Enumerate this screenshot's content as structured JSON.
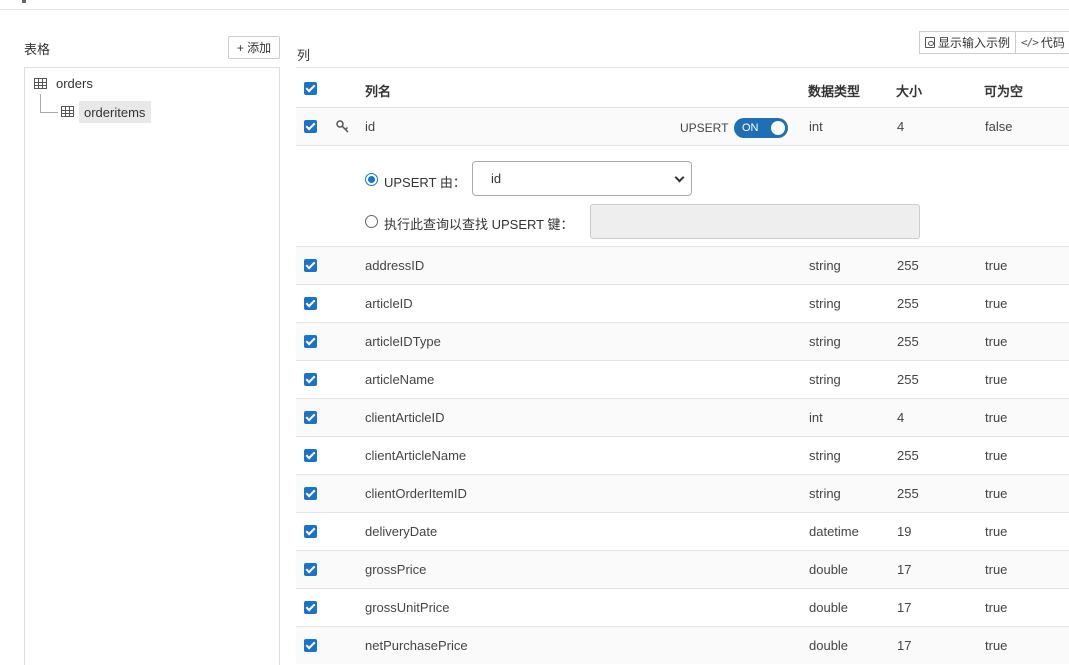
{
  "left_panel": {
    "title": "表格",
    "add_label": "+ 添加",
    "tables": [
      {
        "name": "orders"
      },
      {
        "name": "orderitems"
      }
    ]
  },
  "right_panel": {
    "title": "列",
    "show_example_label": "显示输入示例",
    "code_label": "代码"
  },
  "columns_table": {
    "headers": {
      "name": "列名",
      "type": "数据类型",
      "size": "大小",
      "nullable": "可为空"
    },
    "key_row": {
      "name": "id",
      "upsert_label": "UPSERT",
      "toggle_label": "ON",
      "type": "int",
      "size": "4",
      "nullable": "false"
    },
    "upsert": {
      "by_label": "UPSERT 由：",
      "by_value": "id",
      "query_label": "执行此查询以查找 UPSERT 键：",
      "query_value": ""
    },
    "rows": [
      {
        "name": "addressID",
        "type": "string",
        "size": "255",
        "nullable": "true"
      },
      {
        "name": "articleID",
        "type": "string",
        "size": "255",
        "nullable": "true"
      },
      {
        "name": "articleIDType",
        "type": "string",
        "size": "255",
        "nullable": "true"
      },
      {
        "name": "articleName",
        "type": "string",
        "size": "255",
        "nullable": "true"
      },
      {
        "name": "clientArticleID",
        "type": "int",
        "size": "4",
        "nullable": "true"
      },
      {
        "name": "clientArticleName",
        "type": "string",
        "size": "255",
        "nullable": "true"
      },
      {
        "name": "clientOrderItemID",
        "type": "string",
        "size": "255",
        "nullable": "true"
      },
      {
        "name": "deliveryDate",
        "type": "datetime",
        "size": "19",
        "nullable": "true"
      },
      {
        "name": "grossPrice",
        "type": "double",
        "size": "17",
        "nullable": "true"
      },
      {
        "name": "grossUnitPrice",
        "type": "double",
        "size": "17",
        "nullable": "true"
      },
      {
        "name": "netPurchasePrice",
        "type": "double",
        "size": "17",
        "nullable": "true"
      }
    ]
  },
  "colors": {
    "accent": "#1a73c8",
    "toggle": "#1f6fb5",
    "selected_bg": "#e8e8e8"
  }
}
